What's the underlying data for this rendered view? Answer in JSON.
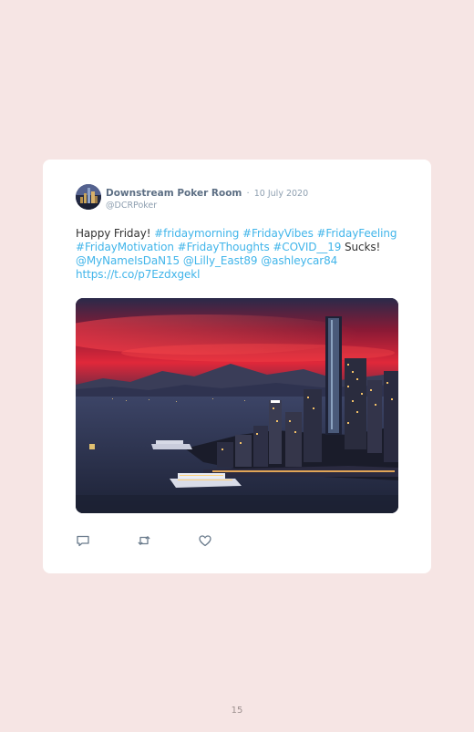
{
  "tweet": {
    "display_name": "Downstream Poker Room",
    "separator": "·",
    "date": "10 July 2020",
    "handle": "@DCRPoker",
    "text_parts": [
      {
        "text": "Happy Friday! ",
        "type": "plain"
      },
      {
        "text": "#fridaymorning",
        "type": "hashtag"
      },
      {
        "text": " ",
        "type": "plain"
      },
      {
        "text": "#FridayVibes",
        "type": "hashtag"
      },
      {
        "text": " ",
        "type": "plain"
      },
      {
        "text": "#FridayFeeling",
        "type": "hashtag"
      },
      {
        "text": " ",
        "type": "plain"
      },
      {
        "text": "#FridayMotivation",
        "type": "hashtag"
      },
      {
        "text": " ",
        "type": "plain"
      },
      {
        "text": "#FridayThoughts",
        "type": "hashtag"
      },
      {
        "text": " ",
        "type": "plain"
      },
      {
        "text": "#COVID__19",
        "type": "hashtag"
      },
      {
        "text": " Sucks! ",
        "type": "plain"
      },
      {
        "text": "@MyNameIsDaN15",
        "type": "mention"
      },
      {
        "text": " ",
        "type": "plain"
      },
      {
        "text": "@Lilly_East89",
        "type": "mention"
      },
      {
        "text": " ",
        "type": "plain"
      },
      {
        "text": "@ashleycar84",
        "type": "mention"
      },
      {
        "text": " ",
        "type": "plain"
      },
      {
        "text": "https://t.co/p7Ezdxgekl",
        "type": "link"
      }
    ],
    "actions": [
      "reply-icon",
      "retweet-icon",
      "like-icon"
    ]
  },
  "page_number": "15",
  "colors": {
    "background": "#f6e5e4",
    "card": "#ffffff",
    "link": "#41b5ea",
    "name": "#5d6f84",
    "muted": "#8fa0b1",
    "icon": "#6a7b8c"
  }
}
